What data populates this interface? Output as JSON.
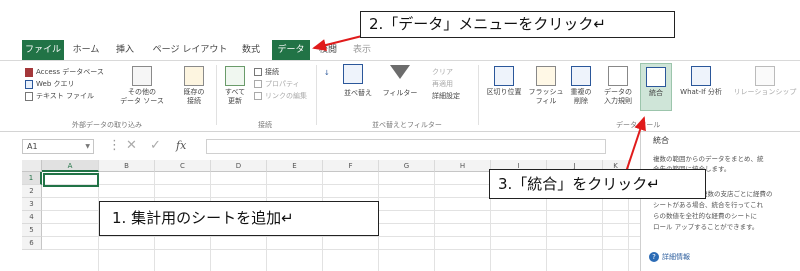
{
  "tabs": {
    "file": "ファイル",
    "home": "ホーム",
    "insert": "挿入",
    "page_layout": "ページ レイアウト",
    "formulas": "数式",
    "data": "データ",
    "review": "校閲",
    "view": "表示"
  },
  "ribbon": {
    "external": {
      "access": "Access データベース",
      "web": "Web クエリ",
      "text": "テキスト ファイル",
      "other_line1": "その他の",
      "other_line2": "データ ソース",
      "existing_line1": "既存の",
      "existing_line2": "接続",
      "group_label": "外部データの取り込み"
    },
    "connections": {
      "refresh_line1": "すべて",
      "refresh_line2": "更新",
      "connections": "接続",
      "properties": "プロパティ",
      "edit_links": "リンクの編集",
      "group_label": "接続"
    },
    "sort_filter": {
      "sort": "並べ替え",
      "filter": "フィルター",
      "clear": "クリア",
      "reapply": "再適用",
      "advanced": "詳細設定",
      "group_label": "並べ替えとフィルター"
    },
    "data_tools": {
      "text_to_columns": "区切り位置",
      "flash_line1": "フラッシュ",
      "flash_line2": "フィル",
      "remove_line1": "重複の",
      "remove_line2": "削除",
      "validation_line1": "データの",
      "validation_line2": "入力規則",
      "consolidate": "統合",
      "whatif": "What-If 分析",
      "relationships": "リレーションシップ",
      "group_label": "データ ツール"
    }
  },
  "formula_bar": {
    "name_box": "A1",
    "fx": "fx"
  },
  "grid": {
    "columns": [
      "A",
      "B",
      "C",
      "D",
      "E",
      "F",
      "G",
      "H",
      "I",
      "J",
      "K"
    ],
    "rows": [
      "1",
      "2",
      "3",
      "4",
      "5",
      "6"
    ]
  },
  "tooltip": {
    "title": "統合",
    "line1": "複数の範囲からのデータをまとめ、統",
    "line2": "合先の範囲に統合します。",
    "line3": "複数の支店ごとに経費の",
    "line4": "シートがある場合、統合を行ってこれ",
    "line5": "らの数値を全社的な経費のシートに",
    "line6": "ロール アップすることができます。",
    "help": "詳細情報"
  },
  "callouts": {
    "step1": "1. 集計用のシートを追加↵",
    "step2": "2.「データ」メニューをクリック↵",
    "step3": "3.「統合」をクリック↵"
  },
  "colors": {
    "excel_green": "#217346",
    "arrow_red": "#e01b1b"
  }
}
